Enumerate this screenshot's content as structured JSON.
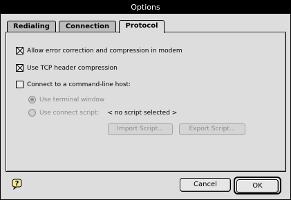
{
  "window": {
    "title": "Options"
  },
  "tabs": [
    {
      "label": "Redialing"
    },
    {
      "label": "Connection"
    },
    {
      "label": "Protocol"
    }
  ],
  "protocol": {
    "allow_error_correction": {
      "label": "Allow error correction and compression in modem",
      "checked": true
    },
    "tcp_header": {
      "label": "Use TCP header compression",
      "checked": true
    },
    "connect_host": {
      "label": "Connect to a command-line host:",
      "checked": false
    },
    "use_terminal": {
      "label": "Use terminal window",
      "selected": true,
      "enabled": false
    },
    "use_script": {
      "label": "Use connect script:",
      "selected": false,
      "enabled": false
    },
    "script_value": "< no script selected >",
    "import_button": "Import Script...",
    "export_button": "Export Script..."
  },
  "buttons": {
    "cancel": "Cancel",
    "ok": "OK"
  },
  "icons": {
    "help": "help-balloon-icon"
  }
}
